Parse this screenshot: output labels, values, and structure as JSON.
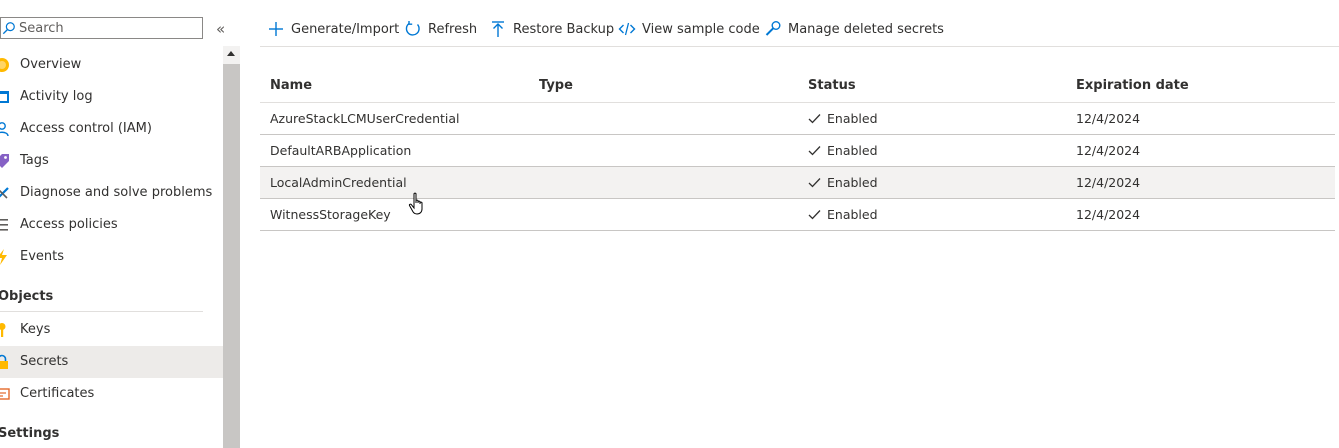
{
  "sidebar": {
    "search": {
      "placeholder": "Search",
      "value": ""
    },
    "collapse_glyph": "«",
    "items": [
      {
        "label": "Overview",
        "icon": "overview-icon"
      },
      {
        "label": "Activity log",
        "icon": "activity-log-icon"
      },
      {
        "label": "Access control (IAM)",
        "icon": "iam-icon"
      },
      {
        "label": "Tags",
        "icon": "tag-icon"
      },
      {
        "label": "Diagnose and solve problems",
        "icon": "wrench-icon"
      },
      {
        "label": "Access policies",
        "icon": "list-icon"
      },
      {
        "label": "Events",
        "icon": "lightning-icon"
      }
    ],
    "sections": [
      {
        "title": "Objects",
        "items": [
          {
            "label": "Keys",
            "icon": "key-icon"
          },
          {
            "label": "Secrets",
            "icon": "secret-icon",
            "selected": true
          },
          {
            "label": "Certificates",
            "icon": "certificate-icon"
          }
        ]
      },
      {
        "title": "Settings",
        "items": []
      }
    ]
  },
  "toolbar": {
    "generate_import": "Generate/Import",
    "refresh": "Refresh",
    "restore_backup": "Restore Backup",
    "view_sample_code": "View sample code",
    "manage_deleted_secrets": "Manage deleted secrets"
  },
  "table": {
    "columns": [
      "Name",
      "Type",
      "Status",
      "Expiration date"
    ],
    "rows": [
      {
        "name": "AzureStackLCMUserCredential",
        "type": "",
        "status": "Enabled",
        "expiration": "12/4/2024"
      },
      {
        "name": "DefaultARBApplication",
        "type": "",
        "status": "Enabled",
        "expiration": "12/4/2024"
      },
      {
        "name": "LocalAdminCredential",
        "type": "",
        "status": "Enabled",
        "expiration": "12/4/2024",
        "hovered": true
      },
      {
        "name": "WitnessStorageKey",
        "type": "",
        "status": "Enabled",
        "expiration": "12/4/2024"
      }
    ]
  },
  "colors": {
    "accent": "#0078d4",
    "selected_bg": "#edebe9",
    "hover_bg": "#f3f2f1",
    "text": "#323130"
  }
}
